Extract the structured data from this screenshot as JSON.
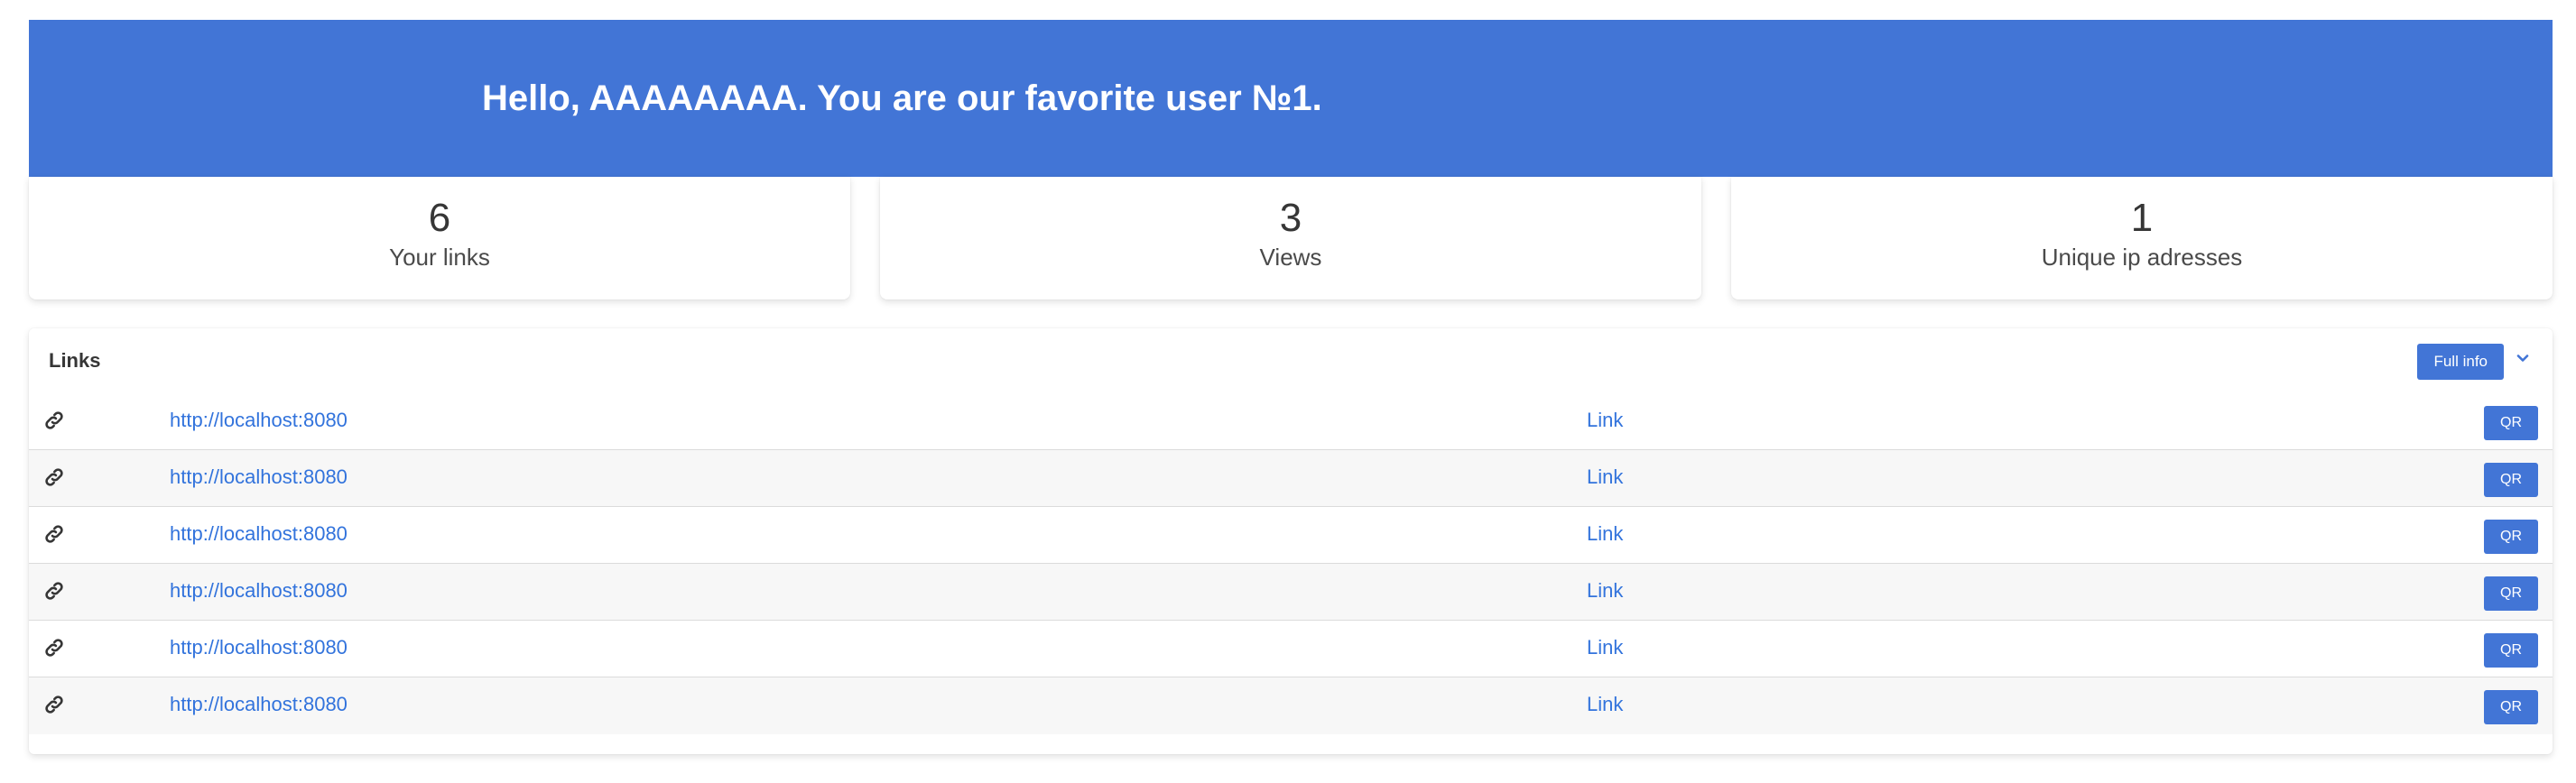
{
  "hero": {
    "greeting": "Hello, AAAAAAAA. You are our favorite user №1.",
    "background_color": "#4275d6"
  },
  "stats": [
    {
      "value": "6",
      "label": "Your links"
    },
    {
      "value": "3",
      "label": "Views"
    },
    {
      "value": "1",
      "label": "Unique ip adresses"
    }
  ],
  "links_panel": {
    "title": "Links",
    "full_info_label": "Full info",
    "expand_icon": "chevron-down-icon",
    "rows": [
      {
        "icon": "link-icon",
        "url": "http://localhost:8080",
        "link_label": "Link",
        "qr_label": "QR"
      },
      {
        "icon": "link-icon",
        "url": "http://localhost:8080",
        "link_label": "Link",
        "qr_label": "QR"
      },
      {
        "icon": "link-icon",
        "url": "http://localhost:8080",
        "link_label": "Link",
        "qr_label": "QR"
      },
      {
        "icon": "link-icon",
        "url": "http://localhost:8080",
        "link_label": "Link",
        "qr_label": "QR"
      },
      {
        "icon": "link-icon",
        "url": "http://localhost:8080",
        "link_label": "Link",
        "qr_label": "QR"
      },
      {
        "icon": "link-icon",
        "url": "http://localhost:8080",
        "link_label": "Link",
        "qr_label": "QR"
      }
    ]
  },
  "colors": {
    "accent": "#4275d6",
    "link": "#3273dc",
    "text": "#363636"
  }
}
